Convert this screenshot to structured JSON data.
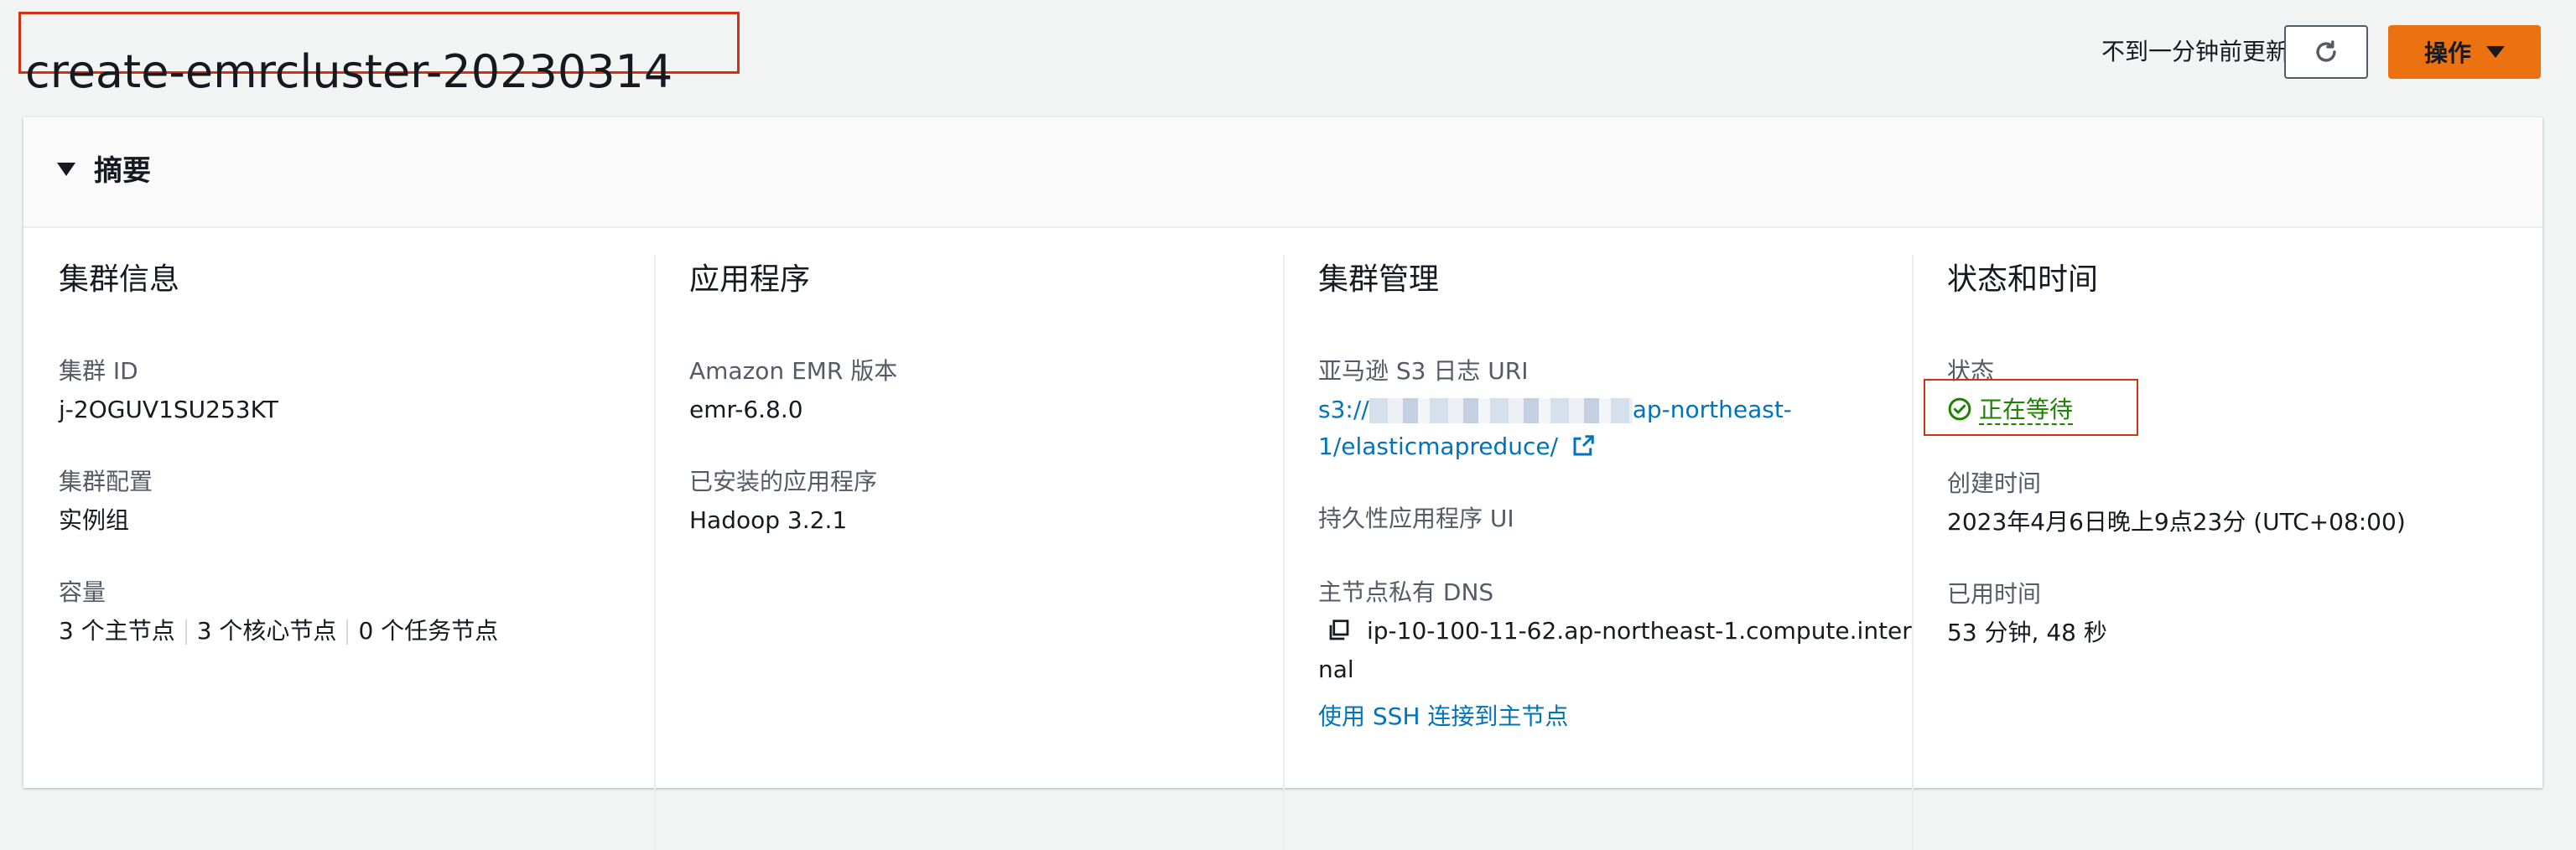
{
  "header": {
    "title": "create-emrcluster-20230314",
    "last_updated": "不到一分钟前更新",
    "actions_label": "操作"
  },
  "summary": {
    "title": "摘要",
    "cluster_info": {
      "heading": "集群信息",
      "id_label": "集群 ID",
      "id_value": "j-2OGUV1SU253KT",
      "config_label": "集群配置",
      "config_value": "实例组",
      "capacity_label": "容量",
      "capacity_primary": "3 个主节点",
      "capacity_core": "3 个核心节点",
      "capacity_task": "0 个任务节点"
    },
    "applications": {
      "heading": "应用程序",
      "emr_label": "Amazon EMR 版本",
      "emr_value": "emr-6.8.0",
      "installed_label": "已安装的应用程序",
      "installed_value": "Hadoop 3.2.1"
    },
    "cluster_management": {
      "heading": "集群管理",
      "s3_label": "亚马逊 S3 日志 URI",
      "s3_prefix": "s3://",
      "s3_suffix": "ap-northeast-",
      "s3_line2": "1/elasticmapreduce/",
      "persistent_ui_label": "持久性应用程序 UI",
      "dns_label": "主节点私有 DNS",
      "dns_line1": "ip-10-100-11-62.ap-northeast-1.compute.inter",
      "dns_line2": "nal",
      "ssh_link": "使用 SSH 连接到主节点"
    },
    "status_time": {
      "heading": "状态和时间",
      "status_label": "状态",
      "status_value": "正在等待",
      "created_label": "创建时间",
      "created_value": "2023年4月6日晚上9点23分 (UTC+08:00)",
      "elapsed_label": "已用时间",
      "elapsed_value": "53 分钟, 48 秒"
    }
  },
  "colors": {
    "accent": "#ec7211",
    "link": "#0073bb",
    "success": "#1d8102",
    "highlight": "#d13212"
  },
  "icons": {
    "refresh": "refresh-icon",
    "caret": "caret-down-icon",
    "expand": "expand-triangle-icon",
    "external": "external-link-icon",
    "copy": "copy-icon",
    "status": "check-circle-icon"
  }
}
